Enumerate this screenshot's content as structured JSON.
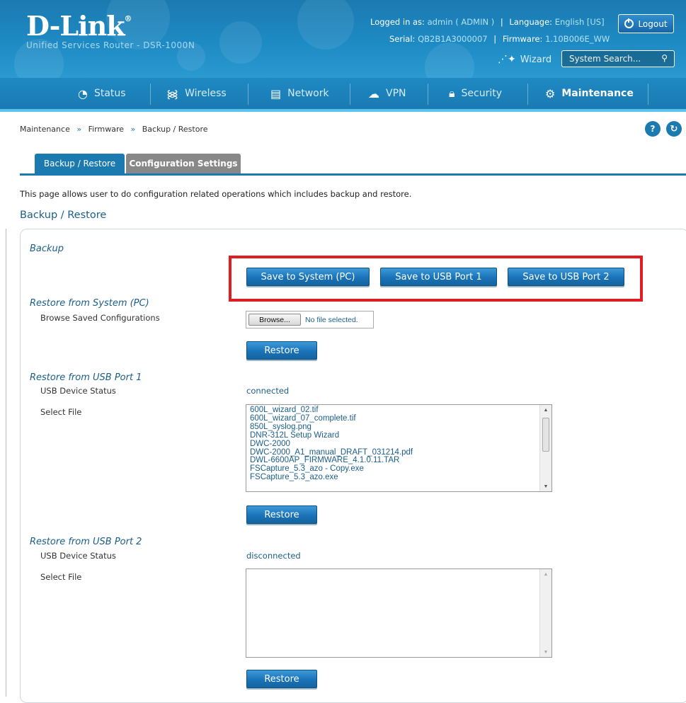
{
  "brand": {
    "logo": "D-Link",
    "subtitle": "Unified Services Router - DSR-1000N"
  },
  "account": {
    "logged_in_label": "Logged in as:",
    "user": "admin ( ADMIN )",
    "language_label": "Language:",
    "language": "English [US]",
    "serial_label": "Serial:",
    "serial": "QB2B1A3000007",
    "firmware_label": "Firmware:",
    "firmware": "1.10B006E_WW",
    "logout": "Logout"
  },
  "header": {
    "wizard": "Wizard",
    "search_placeholder": "System Search..."
  },
  "nav": [
    {
      "label": "Status",
      "icon": "gauge-icon"
    },
    {
      "label": "Wireless",
      "icon": "wifi-icon"
    },
    {
      "label": "Network",
      "icon": "monitor-icon"
    },
    {
      "label": "VPN",
      "icon": "cloud-lock-icon"
    },
    {
      "label": "Security",
      "icon": "lock-icon"
    },
    {
      "label": "Maintenance",
      "icon": "gears-icon",
      "active": true
    }
  ],
  "breadcrumb": [
    "Maintenance",
    "Firmware",
    "Backup / Restore"
  ],
  "tabs": [
    {
      "label": "Backup / Restore",
      "active": true
    },
    {
      "label": "Configuration Settings",
      "active": false
    }
  ],
  "intro": "This page allows user to do configuration related operations which includes backup and restore.",
  "section_title": "Backup / Restore",
  "backup": {
    "title": "Backup",
    "buttons": [
      "Save to System (PC)",
      "Save to USB Port 1",
      "Save to USB Port 2"
    ]
  },
  "restore_pc": {
    "title": "Restore from System (PC)",
    "browse_label": "Browse Saved Configurations",
    "browse_button": "Browse...",
    "file_status": "No file selected.",
    "restore_button": "Restore"
  },
  "restore_usb1": {
    "title": "Restore from USB Port 1",
    "status_label": "USB Device Status",
    "status": "connected",
    "select_label": "Select File",
    "files": [
      "600L_wizard_02.tif",
      "600L_wizard_07_complete.tif",
      "850L_syslog.png",
      "DNR-312L Setup Wizard",
      "DWC-2000",
      "DWC-2000_A1_manual_DRAFT_031214.pdf",
      "DWL-6600AP_FIRMWARE_4.1.0.11.TAR",
      "FSCapture_5.3_azo - Copy.exe",
      "FSCapture_5.3_azo.exe"
    ],
    "restore_button": "Restore"
  },
  "restore_usb2": {
    "title": "Restore from USB Port 2",
    "status_label": "USB Device Status",
    "status": "disconnected",
    "select_label": "Select File",
    "files": [],
    "restore_button": "Restore"
  },
  "colors": {
    "brand_blue": "#1b7ab0",
    "highlight_red": "#e11d24",
    "tab_inactive": "#888888"
  }
}
